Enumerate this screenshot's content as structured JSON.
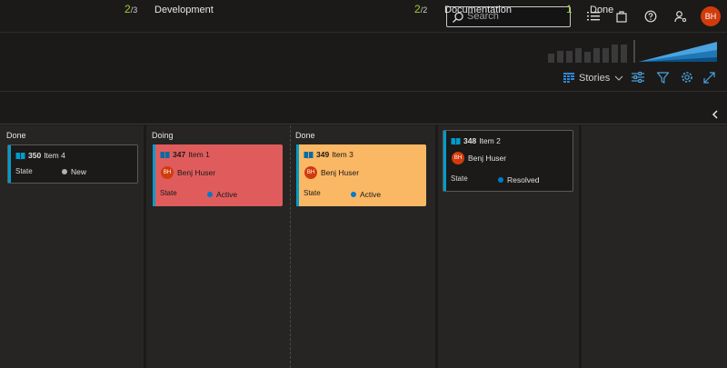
{
  "topbar": {
    "search_placeholder": "Search",
    "avatar_initials": "BH"
  },
  "toolbar": {
    "view_label": "Stories"
  },
  "columns": [
    {
      "title": "",
      "count": "2",
      "limit": "/3",
      "lane_title": "Done"
    },
    {
      "title": "Development",
      "count": "2",
      "limit": "/2",
      "lane_doing": "Doing",
      "lane_done": "Done"
    },
    {
      "title": "Documentation",
      "count": "1"
    },
    {
      "title": "Done"
    }
  ],
  "cards": [
    {
      "id": "350",
      "title": "Item 4",
      "state_label": "State",
      "state": "New",
      "state_color": "#b2b2b2",
      "bg": "#1b1a19",
      "accent": "#009ccc"
    },
    {
      "id": "347",
      "title": "Item 1",
      "assignee": "Benj Huser",
      "initials": "BH",
      "state_label": "State",
      "state": "Active",
      "state_color": "#007acc",
      "bg": "#e05c5c",
      "accent": "#009ccc"
    },
    {
      "id": "349",
      "title": "Item 3",
      "assignee": "Benj Huser",
      "initials": "BH",
      "state_label": "State",
      "state": "Active",
      "state_color": "#007acc",
      "bg": "#fbb864",
      "accent": "#009ccc"
    },
    {
      "id": "348",
      "title": "Item 2",
      "assignee": "Benj Huser",
      "initials": "BH",
      "state_label": "State",
      "state": "Resolved",
      "state_color": "#007acc",
      "bg": "#1b1a19",
      "accent": "#009ccc"
    }
  ],
  "colors": {
    "accent": "#009ccc",
    "count": "#9acd32",
    "avatar": "#d13b0c"
  }
}
